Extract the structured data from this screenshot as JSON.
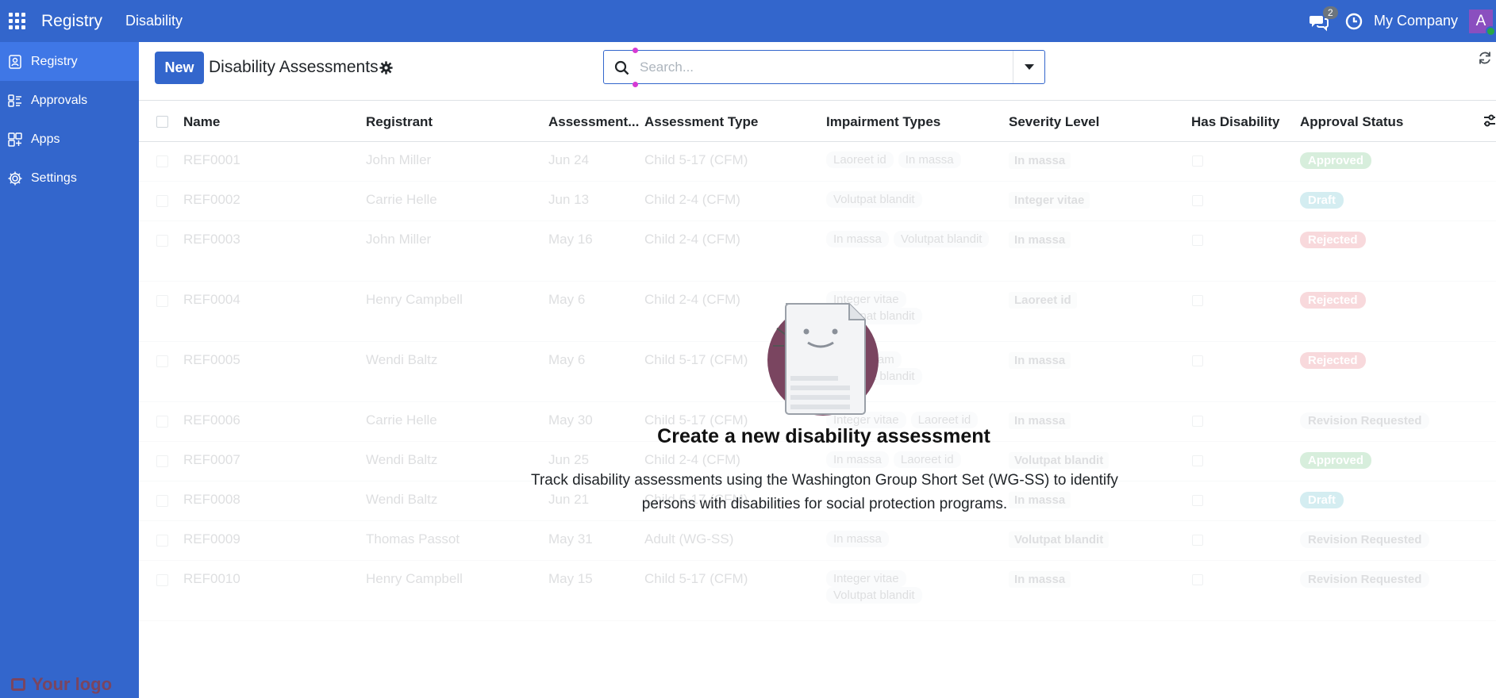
{
  "topbar": {
    "app_name": "Registry",
    "menu": "Disability",
    "notification_count": "2",
    "company": "My Company",
    "avatar_initial": "A"
  },
  "sidebar": {
    "items": [
      {
        "label": "Registry",
        "icon": "registry-icon",
        "active": true
      },
      {
        "label": "Approvals",
        "icon": "approvals-icon"
      },
      {
        "label": "Apps",
        "icon": "apps-grid-icon"
      },
      {
        "label": "Settings",
        "icon": "gear-icon"
      }
    ],
    "logo_text": "Your logo"
  },
  "control": {
    "new_label": "New",
    "title": "Disability Assessments",
    "search_placeholder": "Search..."
  },
  "table": {
    "columns": [
      "Name",
      "Registrant",
      "Assessment...",
      "Assessment Type",
      "Impairment Types",
      "Severity Level",
      "Has Disability",
      "Approval Status"
    ],
    "rows": [
      {
        "name": "REF0001",
        "registrant": "John Miller",
        "date": "Jun 24",
        "type": "Child 5-17 (CFM)",
        "impairments": [
          "Laoreet id",
          "In massa"
        ],
        "severity": "In massa",
        "status": "Approved"
      },
      {
        "name": "REF0002",
        "registrant": "Carrie Helle",
        "date": "Jun 13",
        "type": "Child 2-4 (CFM)",
        "impairments": [
          "Volutpat blandit"
        ],
        "severity": "Integer vitae",
        "status": "Draft"
      },
      {
        "name": "REF0003",
        "registrant": "John Miller",
        "date": "May 16",
        "type": "Child 2-4 (CFM)",
        "impairments": [
          "In massa",
          "Volutpat blandit"
        ],
        "severity": "In massa",
        "status": "Rejected"
      },
      {
        "name": "REF0004",
        "registrant": "Henry Campbell",
        "date": "May 6",
        "type": "Child 2-4 (CFM)",
        "impairments": [
          "Integer vitae",
          "Volutpat blandit"
        ],
        "severity": "Laoreet id",
        "status": "Rejected"
      },
      {
        "name": "REF0005",
        "registrant": "Wendi Baltz",
        "date": "May 6",
        "type": "Child 5-17 (CFM)",
        "impairments": [
          "Diam quam",
          "Volutpat blandit"
        ],
        "severity": "In massa",
        "status": "Rejected"
      },
      {
        "name": "REF0006",
        "registrant": "Carrie Helle",
        "date": "May 30",
        "type": "Child 5-17 (CFM)",
        "impairments": [
          "Integer vitae",
          "Laoreet id"
        ],
        "severity": "In massa",
        "status": "Revision Requested"
      },
      {
        "name": "REF0007",
        "registrant": "Wendi Baltz",
        "date": "Jun 25",
        "type": "Child 2-4 (CFM)",
        "impairments": [
          "In massa",
          "Laoreet id"
        ],
        "severity": "Volutpat blandit",
        "status": "Approved"
      },
      {
        "name": "REF0008",
        "registrant": "Wendi Baltz",
        "date": "Jun 21",
        "type": "Child 5-17 (CFM)",
        "impairments": [],
        "severity": "In massa",
        "status": "Draft"
      },
      {
        "name": "REF0009",
        "registrant": "Thomas Passot",
        "date": "May 31",
        "type": "Adult (WG-SS)",
        "impairments": [
          "In massa"
        ],
        "severity": "Volutpat blandit",
        "status": "Revision Requested"
      },
      {
        "name": "REF0010",
        "registrant": "Henry Campbell",
        "date": "May 15",
        "type": "Child 5-17 (CFM)",
        "impairments": [
          "Integer vitae",
          "Volutpat blandit"
        ],
        "severity": "In massa",
        "status": "Revision Requested"
      }
    ]
  },
  "empty_state": {
    "title": "Create a new disability assessment",
    "text": "Track disability assessments using the Washington Group Short Set (WG-SS) to identify persons with disabilities for social protection programs."
  },
  "colors": {
    "brand": "#3366cc",
    "sidebar_active": "#3f77e6",
    "illustration_circle": "#7a4560"
  }
}
